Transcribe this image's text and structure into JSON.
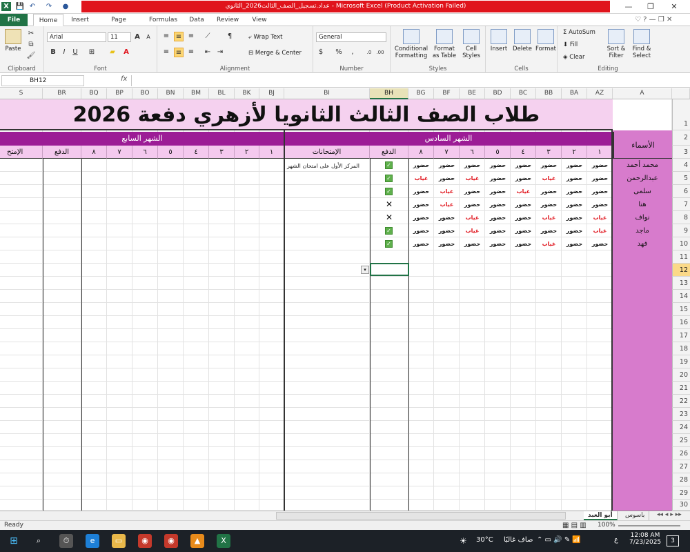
{
  "window": {
    "title": "عداد.تسجيل_الصف_الثالث2026_الثانوي - Microsoft Excel (Product Activation Failed)",
    "min": "—",
    "max": "❐",
    "close": "✕"
  },
  "tabs": [
    "File",
    "Home",
    "Insert",
    "Page Layout",
    "Formulas",
    "Data",
    "Review",
    "View"
  ],
  "ribbon": {
    "clipboard": {
      "paste": "Paste",
      "label": "Clipboard"
    },
    "font": {
      "name": "Arial",
      "size": "11",
      "bold": "B",
      "italic": "I",
      "underline": "U",
      "label": "Font"
    },
    "alignment": {
      "wrap": "Wrap Text",
      "merge": "Merge & Center",
      "label": "Alignment"
    },
    "number": {
      "format": "General",
      "currency": "$",
      "percent": "%",
      "comma": ",",
      "label": "Number"
    },
    "styles": {
      "conditional": "Conditional Formatting",
      "table": "Format as Table",
      "cell": "Cell Styles",
      "label": "Styles"
    },
    "cells": {
      "insert": "Insert",
      "delete": "Delete",
      "format": "Format",
      "label": "Cells"
    },
    "editing": {
      "autosum": "AutoSum",
      "fill": "Fill",
      "clear": "Clear",
      "sort": "Sort & Filter",
      "find": "Find & Select",
      "label": "Editing"
    }
  },
  "formula_bar": {
    "name_box": "BH12",
    "fx": "fx",
    "formula": ""
  },
  "columns_left": [
    "S",
    "BR",
    "BQ",
    "BP",
    "BO",
    "BN",
    "BM",
    "BL",
    "BK",
    "BJ"
  ],
  "columns_right": [
    "BI",
    "BH",
    "BG",
    "BF",
    "BE",
    "BD",
    "BC",
    "BB",
    "BA",
    "AZ",
    "A"
  ],
  "rows": [
    "1",
    "2",
    "3",
    "4",
    "5",
    "6",
    "7",
    "8",
    "9",
    "10",
    "11",
    "12",
    "13",
    "14",
    "15",
    "16",
    "17",
    "18",
    "19",
    "20",
    "21",
    "22",
    "23",
    "24",
    "25",
    "26",
    "27",
    "28",
    "29",
    "30"
  ],
  "selected_row": "12",
  "selected_column": "BH",
  "sheet": {
    "title": "طلاب الصف الثالث الثانويا لأزهري دفعة 2026",
    "month_6": "الشهر السادس",
    "month_7": "الشهر السابع",
    "names_header": "الأسماء",
    "exams_header": "الإمتحانات",
    "pay_header": "الدفع",
    "exams_header_cut": "الإمتح",
    "days": [
      "١",
      "٢",
      "٣",
      "٤",
      "٥",
      "٦",
      "٧",
      "٨"
    ],
    "present": "حضور",
    "absent": "غياب",
    "exam_note": "المركز الأول على امتحان الشهر",
    "students": [
      {
        "name": "محمد أحمد",
        "days": [
          "حضور",
          "حضور",
          "حضور",
          "حضور",
          "حضور",
          "حضور",
          "حضور",
          "حضور"
        ],
        "paid": true
      },
      {
        "name": "عبدالرحمن",
        "days": [
          "حضور",
          "حضور",
          "غياب",
          "حضور",
          "حضور",
          "غياب",
          "حضور",
          "غياب"
        ],
        "paid": true
      },
      {
        "name": "سلمى",
        "days": [
          "حضور",
          "حضور",
          "حضور",
          "غياب",
          "حضور",
          "حضور",
          "غياب",
          "حضور"
        ],
        "paid": true
      },
      {
        "name": "هنا",
        "days": [
          "حضور",
          "حضور",
          "حضور",
          "حضور",
          "حضور",
          "حضور",
          "غياب",
          "حضور"
        ],
        "paid": false
      },
      {
        "name": "نواف",
        "days": [
          "غياب",
          "حضور",
          "غياب",
          "حضور",
          "حضور",
          "غياب",
          "حضور",
          "حضور"
        ],
        "paid": false
      },
      {
        "name": "ماجد",
        "days": [
          "غياب",
          "حضور",
          "حضور",
          "حضور",
          "حضور",
          "غياب",
          "حضور",
          "حضور"
        ],
        "paid": true
      },
      {
        "name": "فهد",
        "days": [
          "حضور",
          "حضور",
          "غياب",
          "حضور",
          "حضور",
          "حضور",
          "حضور",
          "حضور"
        ],
        "paid": true
      }
    ]
  },
  "sheet_tabs": [
    "أبو العبد",
    "باسوس"
  ],
  "status": {
    "ready": "Ready",
    "zoom": "100%"
  },
  "taskbar": {
    "weather": "30°C",
    "weather_text": "صاف غالبًا",
    "time": "12:08 AM",
    "date": "7/23/2025",
    "lang": "ع",
    "notif": "3"
  },
  "colors": {
    "excel_green": "#217346",
    "title_band": "#f5d1ef",
    "month_band": "#9c1c96",
    "names_col": "#d77bcc",
    "absent_red": "#e0141c"
  }
}
